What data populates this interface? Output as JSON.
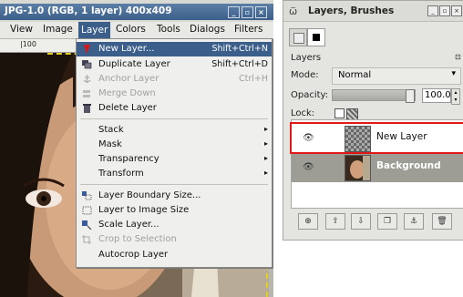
{
  "main_window": {
    "title": "JPG-1.0 (RGB, 1 layer) 400x409",
    "title_buttons": [
      "_",
      "▫",
      "×"
    ],
    "menubar": [
      "View",
      "Image",
      "Layer",
      "Colors",
      "Tools",
      "Dialogs",
      "Filters"
    ],
    "ruler_label": "|100"
  },
  "layer_menu": {
    "items": [
      {
        "label": "New Layer...",
        "shortcut": "Shift+Ctrl+N",
        "icon": "new-layer-icon",
        "state": "highlighted"
      },
      {
        "label": "Duplicate Layer",
        "shortcut": "Shift+Ctrl+D",
        "icon": "duplicate-layer-icon",
        "state": "normal"
      },
      {
        "label": "Anchor Layer",
        "shortcut": "Ctrl+H",
        "icon": "anchor-icon",
        "state": "disabled"
      },
      {
        "label": "Merge Down",
        "shortcut": "",
        "icon": "merge-down-icon",
        "state": "disabled"
      },
      {
        "label": "Delete Layer",
        "shortcut": "",
        "icon": "delete-layer-icon",
        "state": "normal"
      },
      {
        "label": "Stack",
        "shortcut": "",
        "icon": "",
        "state": "submenu"
      },
      {
        "label": "Mask",
        "shortcut": "",
        "icon": "",
        "state": "submenu"
      },
      {
        "label": "Transparency",
        "shortcut": "",
        "icon": "",
        "state": "submenu"
      },
      {
        "label": "Transform",
        "shortcut": "",
        "icon": "",
        "state": "submenu"
      },
      {
        "label": "Layer Boundary Size...",
        "shortcut": "",
        "icon": "boundary-size-icon",
        "state": "normal"
      },
      {
        "label": "Layer to Image Size",
        "shortcut": "",
        "icon": "layer-to-image-icon",
        "state": "normal"
      },
      {
        "label": "Scale Layer...",
        "shortcut": "",
        "icon": "scale-layer-icon",
        "state": "normal"
      },
      {
        "label": "Crop to Selection",
        "shortcut": "",
        "icon": "crop-icon",
        "state": "disabled"
      },
      {
        "label": "Autocrop Layer",
        "shortcut": "",
        "icon": "",
        "state": "normal"
      }
    ],
    "submenu_arrow": "▸"
  },
  "layers_dialog": {
    "title": "Layers, Brushes",
    "gimp_icon": "ѿ",
    "title_buttons": [
      "_",
      "▫",
      "×"
    ],
    "section_label": "Layers",
    "mode_label": "Mode:",
    "mode_value": "Normal",
    "mode_arrow": "▾",
    "opacity_label": "Opacity:",
    "opacity_value": "100.0",
    "opacity_fraction": 1.0,
    "lock_label": "Lock:",
    "layers": [
      {
        "name": "New Layer",
        "visible_icon": "👁",
        "selected": false,
        "thumb": "transparent"
      },
      {
        "name": "Background",
        "visible_icon": "👁",
        "selected": true,
        "thumb": "photo"
      }
    ],
    "bottom_buttons": [
      "⊕",
      "⇧",
      "⇩",
      "❐",
      "⚓",
      "🗑"
    ]
  },
  "colors": {
    "title_blue": "#3b5f8a",
    "highlight_red": "#e01818",
    "guide_yellow": "#e0d020"
  }
}
